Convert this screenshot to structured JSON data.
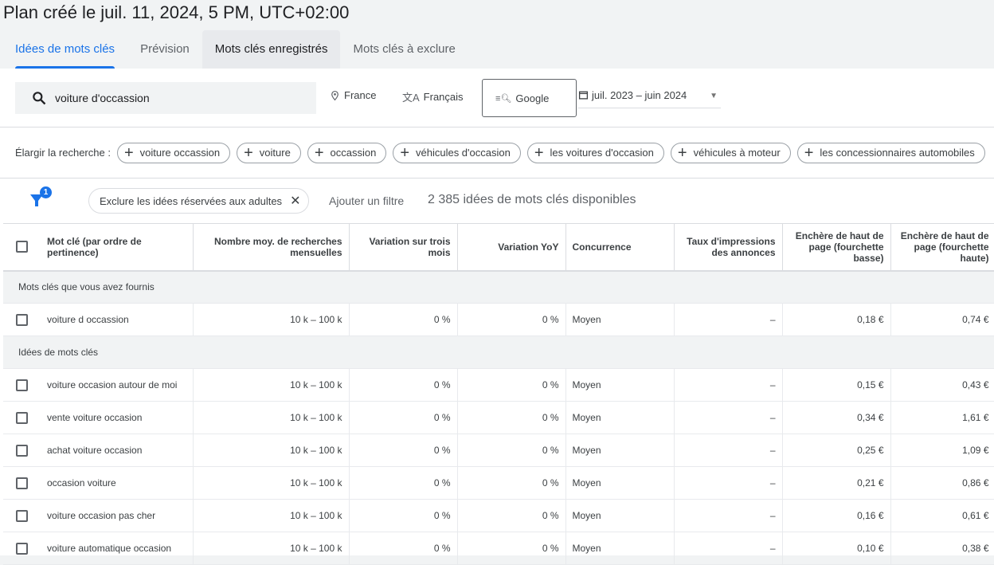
{
  "title": "Plan créé le juil. 11, 2024, 5 PM, UTC+02:00",
  "tabs": [
    "Idées de mots clés",
    "Prévision",
    "Mots clés enregistrés",
    "Mots clés à exclure"
  ],
  "search": {
    "value": "voiture d'occassion",
    "location": "France",
    "language": "Français",
    "network": "Google",
    "date_range": "juil. 2023 – juin 2024"
  },
  "broaden": {
    "label": "Élargir la recherche :",
    "chips": [
      "voiture occassion",
      "voiture",
      "occassion",
      "véhicules d'occasion",
      "les voitures d'occasion",
      "véhicules à moteur",
      "les concessionnaires automobiles"
    ]
  },
  "filters": {
    "badge": "1",
    "active_filter": "Exclure les idées réservées aux adultes",
    "add_filter": "Ajouter un filtre",
    "count": "2 385 idées de mots clés disponibles"
  },
  "table": {
    "headers": [
      "Mot clé (par ordre de pertinence)",
      "Nombre moy. de recherches mensuelles",
      "Variation sur trois mois",
      "Variation YoY",
      "Concurrence",
      "Taux d'impressions des annonces",
      "Enchère de haut de page (fourchette basse)",
      "Enchère de haut de page (fourchette haute)"
    ],
    "group1": "Mots clés que vous avez fournis",
    "provided": [
      [
        "voiture d occassion",
        "10 k – 100 k",
        "0 %",
        "0 %",
        "Moyen",
        "–",
        "0,18 €",
        "0,74 €"
      ]
    ],
    "group2": "Idées de mots clés",
    "ideas": [
      [
        "voiture occasion autour de moi",
        "10 k – 100 k",
        "0 %",
        "0 %",
        "Moyen",
        "–",
        "0,15 €",
        "0,43 €"
      ],
      [
        "vente voiture occasion",
        "10 k – 100 k",
        "0 %",
        "0 %",
        "Moyen",
        "–",
        "0,34 €",
        "1,61 €"
      ],
      [
        "achat voiture occasion",
        "10 k – 100 k",
        "0 %",
        "0 %",
        "Moyen",
        "–",
        "0,25 €",
        "1,09 €"
      ],
      [
        "occasion voiture",
        "10 k – 100 k",
        "0 %",
        "0 %",
        "Moyen",
        "–",
        "0,21 €",
        "0,86 €"
      ],
      [
        "voiture occasion pas cher",
        "10 k – 100 k",
        "0 %",
        "0 %",
        "Moyen",
        "–",
        "0,16 €",
        "0,61 €"
      ],
      [
        "voiture automatique occasion",
        "10 k – 100 k",
        "0 %",
        "0 %",
        "Moyen",
        "–",
        "0,10 €",
        "0,38 €"
      ]
    ]
  },
  "colors": {
    "accent": "#1a73e8"
  }
}
